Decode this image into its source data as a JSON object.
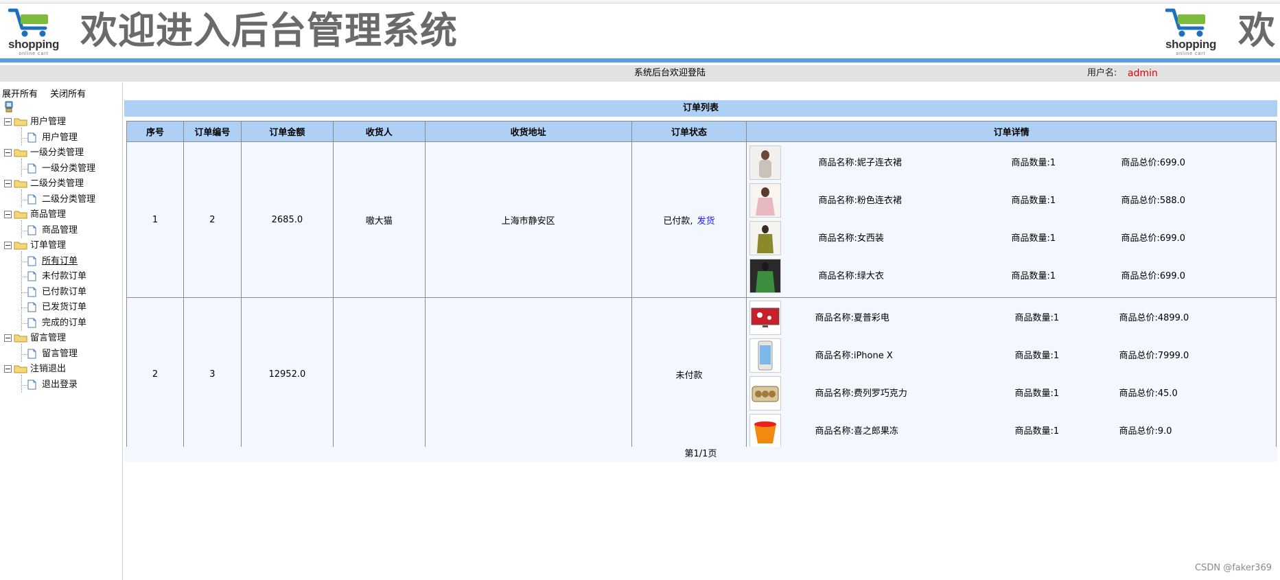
{
  "banner": {
    "logo_word": "shopping",
    "logo_sub": "online cart",
    "title": "欢迎进入后台管理系统",
    "title_repeat": "欢"
  },
  "infobar": {
    "welcome": "系统后台欢迎登陆",
    "username_label": "用户名:",
    "username_value": "admin"
  },
  "sidebar": {
    "expand_all": "展开所有",
    "collapse_all": "关闭所有",
    "groups": [
      {
        "label": "用户管理",
        "children": [
          "用户管理"
        ]
      },
      {
        "label": "一级分类管理",
        "children": [
          "一级分类管理"
        ]
      },
      {
        "label": "二级分类管理",
        "children": [
          "二级分类管理"
        ]
      },
      {
        "label": "商品管理",
        "children": [
          "商品管理"
        ]
      },
      {
        "label": "订单管理",
        "children": [
          "所有订单",
          "未付款订单",
          "已付款订单",
          "已发货订单",
          "完成的订单"
        ]
      },
      {
        "label": "留言管理",
        "children": [
          "留言管理"
        ]
      },
      {
        "label": "注销退出",
        "children": [
          "退出登录"
        ]
      }
    ]
  },
  "orders": {
    "title": "订单列表",
    "headers": [
      "序号",
      "订单编号",
      "订单金额",
      "收货人",
      "收货地址",
      "订单状态",
      "订单详情"
    ],
    "rows": [
      {
        "seq": "1",
        "order_no": "2",
        "amount": "2685.0",
        "receiver": "嗷大猫",
        "address": "上海市静安区",
        "status": "已付款,",
        "action": "发货",
        "items": [
          {
            "name_label": "商品名称:",
            "name": "妮子连衣裙",
            "qty_label": "商品数量:",
            "qty": "1",
            "total_label": "商品总价:",
            "total": "699.0",
            "thumb_color": "#c9c2bb"
          },
          {
            "name_label": "商品名称:",
            "name": "粉色连衣裙",
            "qty_label": "商品数量:",
            "qty": "1",
            "total_label": "商品总价:",
            "total": "588.0",
            "thumb_color": "#e7b8c0"
          },
          {
            "name_label": "商品名称:",
            "name": "女西装",
            "qty_label": "商品数量:",
            "qty": "1",
            "total_label": "商品总价:",
            "total": "699.0",
            "thumb_color": "#8a8a2a"
          },
          {
            "name_label": "商品名称:",
            "name": "绿大衣",
            "qty_label": "商品数量:",
            "qty": "1",
            "total_label": "商品总价:",
            "total": "699.0",
            "thumb_color": "#3c8d3c"
          }
        ]
      },
      {
        "seq": "2",
        "order_no": "3",
        "amount": "12952.0",
        "receiver": "",
        "address": "",
        "status": "未付款",
        "action": "",
        "items": [
          {
            "name_label": "商品名称:",
            "name": "夏普彩电",
            "qty_label": "商品数量:",
            "qty": "1",
            "total_label": "商品总价:",
            "total": "4899.0",
            "thumb_color": "#c8202a"
          },
          {
            "name_label": "商品名称:",
            "name": "iPhone X",
            "qty_label": "商品数量:",
            "qty": "1",
            "total_label": "商品总价:",
            "total": "7999.0",
            "thumb_color": "#e8e4de"
          },
          {
            "name_label": "商品名称:",
            "name": "费列罗巧克力",
            "qty_label": "商品数量:",
            "qty": "1",
            "total_label": "商品总价:",
            "total": "45.0",
            "thumb_color": "#a07a3a"
          },
          {
            "name_label": "商品名称:",
            "name": "喜之郎果冻",
            "qty_label": "商品数量:",
            "qty": "1",
            "total_label": "商品总价:",
            "total": "9.0",
            "thumb_color": "#f08a10"
          }
        ]
      }
    ],
    "pager": "第1/1页"
  },
  "watermark": "CSDN @faker369",
  "colors": {
    "header_bg": "#aed0f5",
    "blue_line": "#5aa0e0",
    "admin_red": "#e00000",
    "link_blue": "#1a1aff"
  }
}
